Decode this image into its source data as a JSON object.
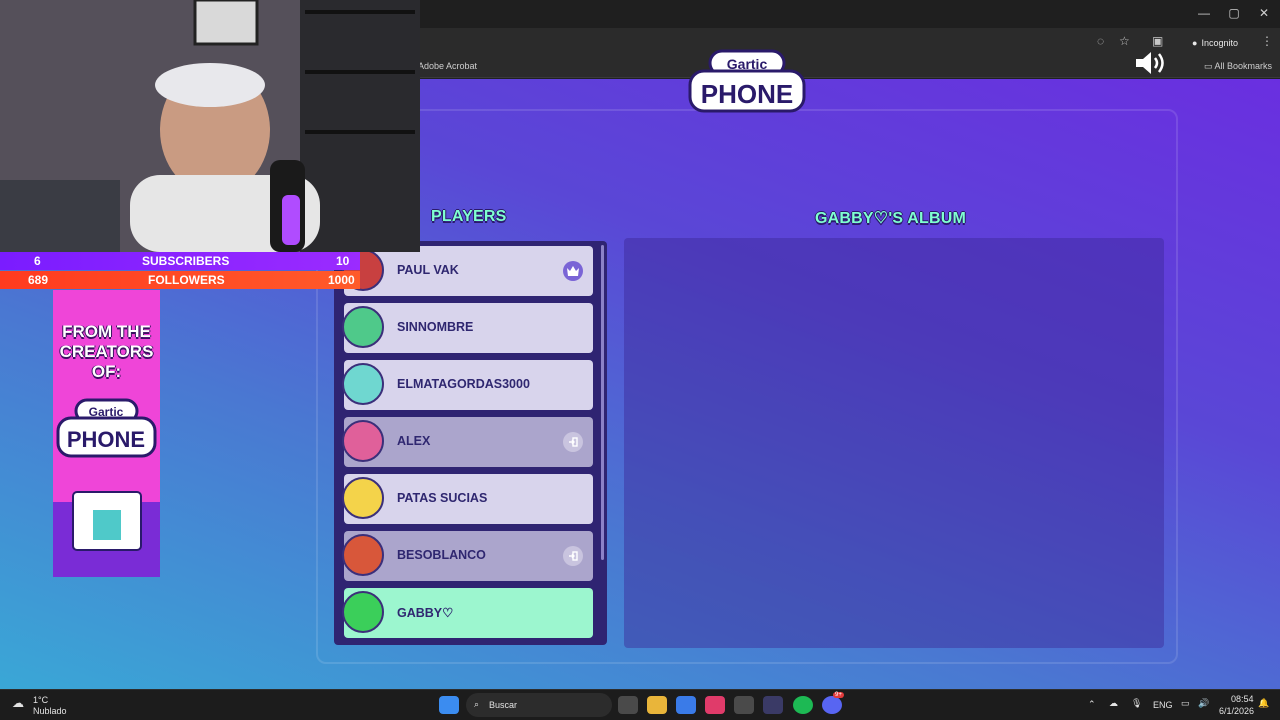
{
  "browser": {
    "bookmark_folder": "Adobe Acrobat",
    "all_bookmarks": "All Bookmarks",
    "incognito_label": "Incognito",
    "window_controls": [
      "minimize-icon",
      "restore-icon",
      "close-icon"
    ]
  },
  "game": {
    "logo_top": "Gartic",
    "logo_bottom": "PHONE",
    "players_title": "PLAYERS",
    "album_title": "GABBY♡'S ALBUM",
    "players": [
      {
        "name": "PAUL VAK",
        "state": "normal",
        "badge": "crown-icon"
      },
      {
        "name": "SINNOMBRE",
        "state": "normal",
        "badge": ""
      },
      {
        "name": "ELMATAGORDAS3000",
        "state": "normal",
        "badge": ""
      },
      {
        "name": "ALEX",
        "state": "dim",
        "badge": "exit-icon"
      },
      {
        "name": "PATAS SUCIAS",
        "state": "normal",
        "badge": ""
      },
      {
        "name": "BESOBLANCO",
        "state": "dim",
        "badge": "exit-icon"
      },
      {
        "name": "GABBY♡",
        "state": "active",
        "badge": ""
      }
    ]
  },
  "overlay": {
    "subs_count": "6",
    "subs_label": "SUBSCRIBERS",
    "subs_goal": "10",
    "followers_count": "689",
    "followers_label": "FOLLOWERS",
    "followers_goal": "1000",
    "promo_text": "FROM THE CREATORS OF:",
    "promo_logo_top": "Gartic",
    "promo_logo_bottom": "PHONE",
    "colors": {
      "subs": "#9b2bff",
      "followers": "#ff3b1f",
      "promo": "#ef45d8"
    }
  },
  "taskbar": {
    "weather_temp": "1°C",
    "weather_desc": "Nublado",
    "search_placeholder": "Buscar",
    "language": "ENG",
    "time": "08:54",
    "date": "6/1/2026",
    "discord_badge": "9+"
  }
}
